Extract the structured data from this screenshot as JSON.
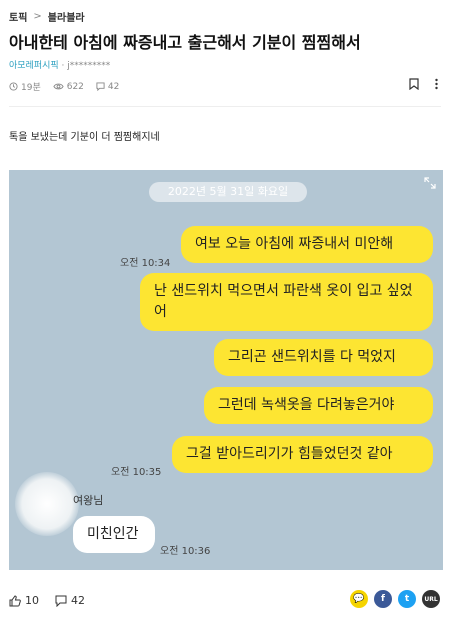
{
  "breadcrumb": {
    "topic": "토픽",
    "separator": ">",
    "board": "블라블라"
  },
  "post": {
    "title": "아내한테 아침에 짜증내고 출근해서 기분이 찜찜해서",
    "company": "아모레퍼시픽",
    "author_separator": " · ",
    "author": "j*********",
    "time": "19분",
    "views": "622",
    "comments": "42",
    "body": "톡을 보냈는데 기분이 더 찜찜해지네"
  },
  "chat": {
    "date": "2022년 5월 31일 화요일",
    "sent": [
      {
        "text": "여보 오늘 아침에 짜증내서 미안해"
      },
      {
        "text": "난 샌드위치 먹으면서 파란색 옷이 입고 싶었어"
      },
      {
        "text": "그리곤 샌드위치를 다 먹었지"
      },
      {
        "text": "그런데 녹색옷을 다려놓은거야"
      },
      {
        "text": "그걸 받아드리기가 힘들었던것 같아"
      }
    ],
    "sent_times": [
      "오전 10:34",
      "오전 10:35"
    ],
    "sender_name": "여왕님",
    "reply": "미친인간",
    "reply_time": "오전 10:36"
  },
  "footer": {
    "likes": "10",
    "comments": "42"
  },
  "share": {
    "kakao": "💬",
    "facebook": "f",
    "twitter": "t",
    "url": "URL"
  },
  "colors": {
    "chat_bg": "#b3c6d3",
    "bubble_yellow": "#fde532",
    "company": "#2a9fbf",
    "kakao": "#f5d400",
    "facebook": "#3b5998",
    "twitter": "#1da1f2",
    "url": "#333333"
  },
  "icons": {
    "clock": "clock-icon",
    "eye": "eye-icon",
    "comment": "comment-icon",
    "bookmark": "bookmark-icon",
    "more": "more-icon",
    "like": "thumbs-up-icon",
    "expand": "expand-icon"
  }
}
